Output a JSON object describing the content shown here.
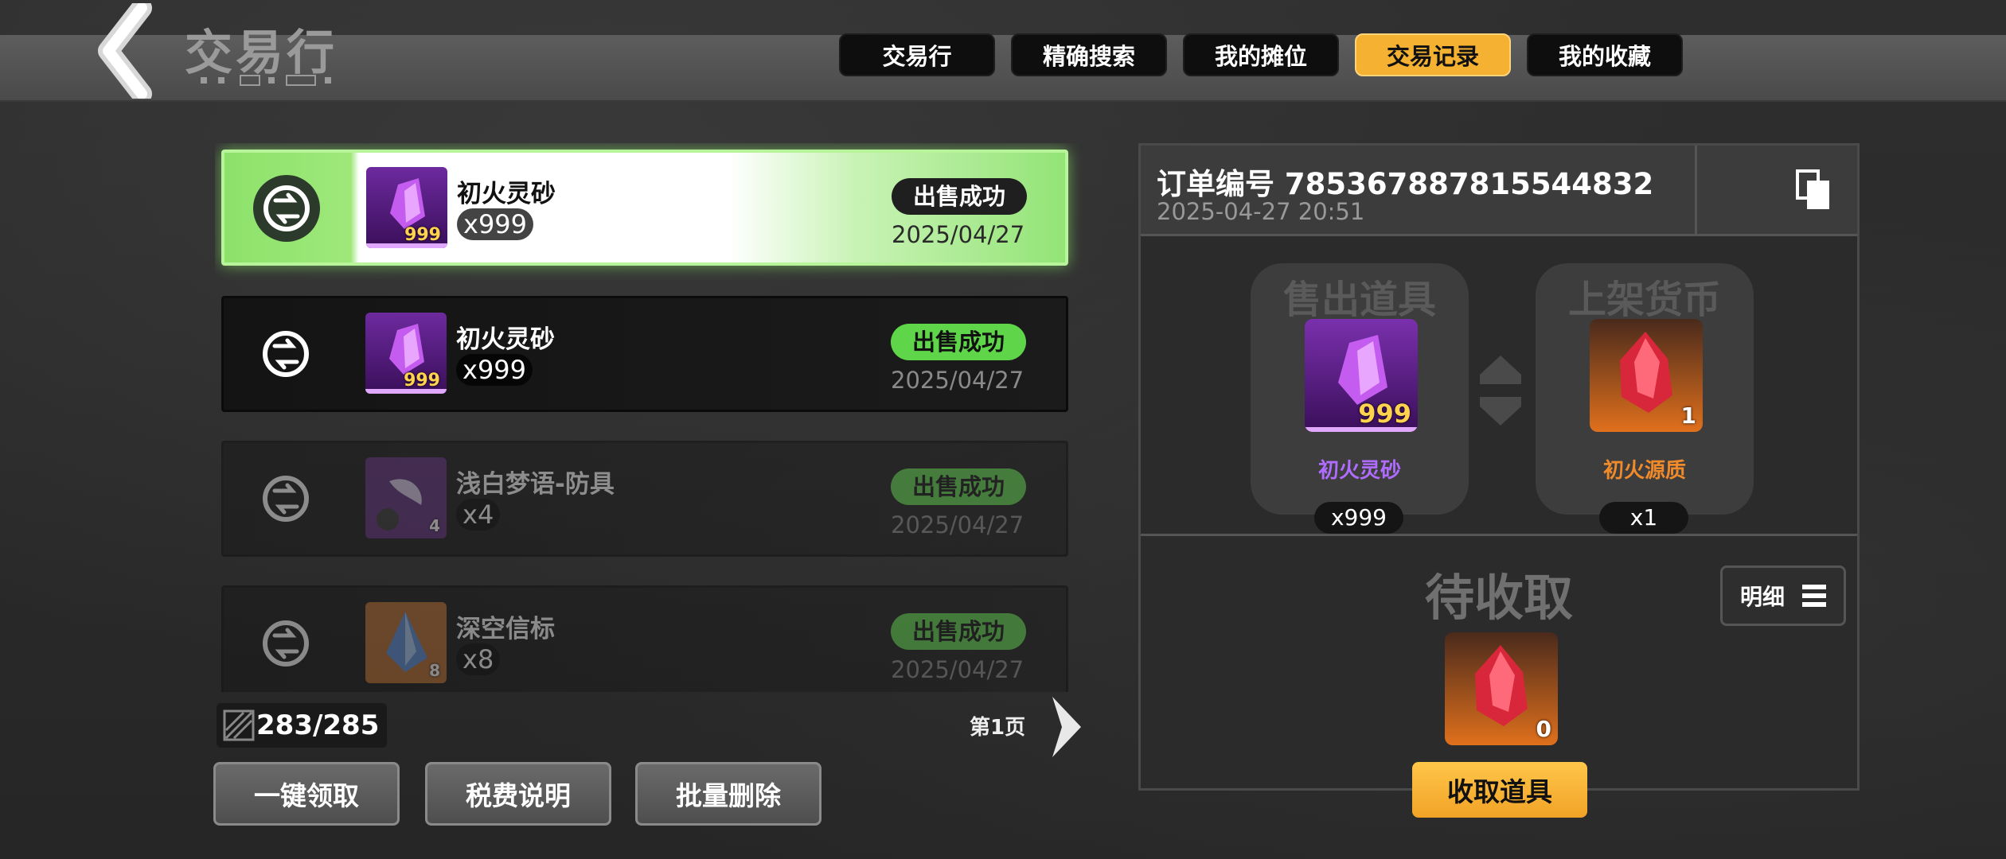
{
  "header": {
    "title": "交易行"
  },
  "tabs": [
    {
      "label": "交易行"
    },
    {
      "label": "精确搜索"
    },
    {
      "label": "我的摊位"
    },
    {
      "label": "交易记录",
      "active": true
    },
    {
      "label": "我的收藏"
    }
  ],
  "records": [
    {
      "name": "初火灵砂",
      "qty": "x999",
      "badge": "999",
      "status": "出售成功",
      "date": "2025/04/27"
    },
    {
      "name": "初火灵砂",
      "qty": "x999",
      "badge": "999",
      "status": "出售成功",
      "date": "2025/04/27"
    },
    {
      "name": "浅白梦语-防具",
      "qty": "x4",
      "badge": "4",
      "status": "出售成功",
      "date": "2025/04/27"
    },
    {
      "name": "深空信标",
      "qty": "x8",
      "badge": "8",
      "status": "出售成功",
      "date": "2025/04/27"
    }
  ],
  "footer": {
    "counter": "283/285",
    "page": "第1页",
    "buttons": {
      "claim_all": "一键领取",
      "tax_info": "税费说明",
      "batch_delete": "批量删除"
    }
  },
  "detail": {
    "order_no": "订单编号 785367887815544832",
    "order_time": "2025-04-27 20:51",
    "sold": {
      "title": "售出道具",
      "name": "初火灵砂",
      "badge": "999",
      "qty": "x999",
      "name_color": "#b06cff"
    },
    "listed": {
      "title": "上架货币",
      "name": "初火源质",
      "badge": "1",
      "qty": "x1",
      "name_color": "#f08a2a"
    },
    "pending_title": "待收取",
    "pending_badge": "0",
    "detail_label": "明细",
    "collect_label": "收取道具"
  }
}
